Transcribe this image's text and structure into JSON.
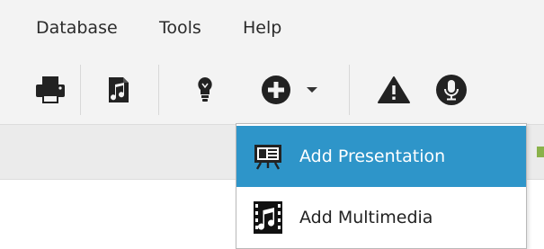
{
  "menubar": {
    "items": [
      {
        "label": "Database"
      },
      {
        "label": "Tools"
      },
      {
        "label": "Help"
      }
    ]
  },
  "toolbar": {
    "buttons": [
      {
        "icon": "printer-icon"
      },
      {
        "icon": "music-file-icon"
      },
      {
        "icon": "lightbulb-icon"
      },
      {
        "icon": "add-circle-icon",
        "has_dropdown": true
      },
      {
        "icon": "warning-icon"
      },
      {
        "icon": "microphone-icon"
      }
    ]
  },
  "dropdown": {
    "items": [
      {
        "label": "Add Presentation",
        "icon": "presentation-icon",
        "highlighted": true
      },
      {
        "label": "Add Multimedia",
        "icon": "film-music-icon",
        "highlighted": false
      }
    ]
  },
  "colors": {
    "menubar_bg": "#f3f3f3",
    "highlight": "#2e95c9",
    "icon": "#222222"
  }
}
